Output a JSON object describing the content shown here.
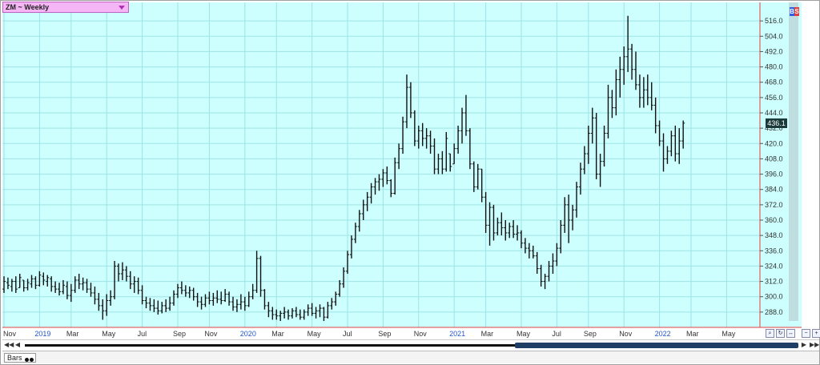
{
  "window": {
    "symbol_label": "ZM ~ Weekly",
    "study_tab_label": "Bars",
    "last_price_label": "436.1",
    "badge_b": "B",
    "badge_s": "S"
  },
  "colors": {
    "plot_background": "#ccfffe",
    "grid": "#9fe3e6",
    "bars": "#111111",
    "right_axis_line": "#e04040",
    "right_strip": "#c0dde0"
  },
  "chart_data": {
    "type": "ohlc",
    "title": "ZM ~ Weekly",
    "ylim": [
      276,
      528
    ],
    "y_ticks": [
      288.0,
      300.0,
      312.0,
      324.0,
      336.0,
      348.0,
      360.0,
      372.0,
      384.0,
      396.0,
      408.0,
      420.0,
      432.0,
      444.0,
      456.0,
      468.0,
      480.0,
      492.0,
      504.0,
      516.0
    ],
    "y_tick_labels": [
      "288.0",
      "300.0",
      "312.0",
      "324.0",
      "336.0",
      "348.0",
      "360.0",
      "372.0",
      "384.0",
      "396.0",
      "408.0",
      "420.0",
      "432.0",
      "444.0",
      "456.0",
      "468.0",
      "480.0",
      "492.0",
      "504.0",
      "516.0"
    ],
    "x_labels": [
      {
        "label": "Nov",
        "bar": 0,
        "year": false
      },
      {
        "label": "2019",
        "bar": 9,
        "year": true
      },
      {
        "label": "Mar",
        "bar": 17,
        "year": false
      },
      {
        "label": "May",
        "bar": 26,
        "year": false
      },
      {
        "label": "Jul",
        "bar": 35,
        "year": false
      },
      {
        "label": "Sep",
        "bar": 44,
        "year": false
      },
      {
        "label": "Nov",
        "bar": 52,
        "year": false
      },
      {
        "label": "2020",
        "bar": 61,
        "year": true
      },
      {
        "label": "Mar",
        "bar": 69,
        "year": false
      },
      {
        "label": "May",
        "bar": 78,
        "year": false
      },
      {
        "label": "Jul",
        "bar": 87,
        "year": false
      },
      {
        "label": "Sep",
        "bar": 96,
        "year": false
      },
      {
        "label": "Nov",
        "bar": 105,
        "year": false
      },
      {
        "label": "2021",
        "bar": 114,
        "year": true
      },
      {
        "label": "Mar",
        "bar": 122,
        "year": false
      },
      {
        "label": "May",
        "bar": 131,
        "year": false
      },
      {
        "label": "Jul",
        "bar": 140,
        "year": false
      },
      {
        "label": "Sep",
        "bar": 148,
        "year": false
      },
      {
        "label": "Nov",
        "bar": 157,
        "year": false
      },
      {
        "label": "2022",
        "bar": 166,
        "year": true
      },
      {
        "label": "Mar",
        "bar": 174,
        "year": false
      },
      {
        "label": "May",
        "bar": 183,
        "year": false
      }
    ],
    "bar_count": 190,
    "bars": [
      {
        "h": 316,
        "l": 303,
        "o": 306,
        "c": 312
      },
      {
        "h": 315,
        "l": 306,
        "o": 311,
        "c": 309
      },
      {
        "h": 314,
        "l": 304,
        "o": 308,
        "c": 312
      },
      {
        "h": 316,
        "l": 303,
        "o": 312,
        "c": 306
      },
      {
        "h": 318,
        "l": 307,
        "o": 307,
        "c": 315
      },
      {
        "h": 313,
        "l": 304,
        "o": 313,
        "c": 307
      },
      {
        "h": 314,
        "l": 305,
        "o": 307,
        "c": 311
      },
      {
        "h": 317,
        "l": 307,
        "o": 310,
        "c": 314
      },
      {
        "h": 316,
        "l": 306,
        "o": 314,
        "c": 309
      },
      {
        "h": 320,
        "l": 308,
        "o": 309,
        "c": 317
      },
      {
        "h": 319,
        "l": 309,
        "o": 316,
        "c": 313
      },
      {
        "h": 317,
        "l": 308,
        "o": 312,
        "c": 315
      },
      {
        "h": 316,
        "l": 304,
        "o": 314,
        "c": 308
      },
      {
        "h": 312,
        "l": 303,
        "o": 308,
        "c": 306
      },
      {
        "h": 311,
        "l": 301,
        "o": 306,
        "c": 304
      },
      {
        "h": 313,
        "l": 302,
        "o": 304,
        "c": 309
      },
      {
        "h": 312,
        "l": 298,
        "o": 308,
        "c": 301
      },
      {
        "h": 310,
        "l": 296,
        "o": 301,
        "c": 305
      },
      {
        "h": 316,
        "l": 303,
        "o": 305,
        "c": 313
      },
      {
        "h": 318,
        "l": 306,
        "o": 313,
        "c": 310
      },
      {
        "h": 315,
        "l": 305,
        "o": 310,
        "c": 311
      },
      {
        "h": 314,
        "l": 303,
        "o": 311,
        "c": 306
      },
      {
        "h": 311,
        "l": 300,
        "o": 306,
        "c": 303
      },
      {
        "h": 308,
        "l": 294,
        "o": 303,
        "c": 298
      },
      {
        "h": 303,
        "l": 289,
        "o": 298,
        "c": 293
      },
      {
        "h": 298,
        "l": 282,
        "o": 293,
        "c": 289
      },
      {
        "h": 302,
        "l": 285,
        "o": 289,
        "c": 297
      },
      {
        "h": 305,
        "l": 293,
        "o": 297,
        "c": 300
      },
      {
        "h": 328,
        "l": 298,
        "o": 300,
        "c": 324
      },
      {
        "h": 326,
        "l": 312,
        "o": 324,
        "c": 318
      },
      {
        "h": 327,
        "l": 313,
        "o": 318,
        "c": 321
      },
      {
        "h": 324,
        "l": 312,
        "o": 321,
        "c": 316
      },
      {
        "h": 320,
        "l": 306,
        "o": 316,
        "c": 310
      },
      {
        "h": 316,
        "l": 303,
        "o": 310,
        "c": 312
      },
      {
        "h": 315,
        "l": 302,
        "o": 312,
        "c": 305
      },
      {
        "h": 309,
        "l": 294,
        "o": 305,
        "c": 297
      },
      {
        "h": 300,
        "l": 291,
        "o": 297,
        "c": 295
      },
      {
        "h": 299,
        "l": 289,
        "o": 295,
        "c": 293
      },
      {
        "h": 298,
        "l": 288,
        "o": 293,
        "c": 291
      },
      {
        "h": 297,
        "l": 286,
        "o": 291,
        "c": 289
      },
      {
        "h": 296,
        "l": 287,
        "o": 289,
        "c": 293
      },
      {
        "h": 298,
        "l": 288,
        "o": 293,
        "c": 291
      },
      {
        "h": 300,
        "l": 289,
        "o": 291,
        "c": 295
      },
      {
        "h": 305,
        "l": 293,
        "o": 295,
        "c": 302
      },
      {
        "h": 310,
        "l": 299,
        "o": 302,
        "c": 307
      },
      {
        "h": 312,
        "l": 302,
        "o": 307,
        "c": 305
      },
      {
        "h": 309,
        "l": 300,
        "o": 305,
        "c": 303
      },
      {
        "h": 308,
        "l": 299,
        "o": 303,
        "c": 305
      },
      {
        "h": 307,
        "l": 297,
        "o": 305,
        "c": 300
      },
      {
        "h": 303,
        "l": 292,
        "o": 300,
        "c": 296
      },
      {
        "h": 300,
        "l": 290,
        "o": 296,
        "c": 294
      },
      {
        "h": 302,
        "l": 292,
        "o": 294,
        "c": 299
      },
      {
        "h": 304,
        "l": 294,
        "o": 299,
        "c": 297
      },
      {
        "h": 303,
        "l": 293,
        "o": 297,
        "c": 299
      },
      {
        "h": 305,
        "l": 295,
        "o": 299,
        "c": 298
      },
      {
        "h": 304,
        "l": 294,
        "o": 298,
        "c": 297
      },
      {
        "h": 306,
        "l": 296,
        "o": 297,
        "c": 302
      },
      {
        "h": 304,
        "l": 293,
        "o": 302,
        "c": 296
      },
      {
        "h": 300,
        "l": 289,
        "o": 296,
        "c": 292
      },
      {
        "h": 298,
        "l": 288,
        "o": 292,
        "c": 294
      },
      {
        "h": 302,
        "l": 290,
        "o": 294,
        "c": 296
      },
      {
        "h": 300,
        "l": 289,
        "o": 296,
        "c": 293
      },
      {
        "h": 304,
        "l": 292,
        "o": 293,
        "c": 300
      },
      {
        "h": 310,
        "l": 298,
        "o": 300,
        "c": 305
      },
      {
        "h": 336,
        "l": 303,
        "o": 305,
        "c": 330
      },
      {
        "h": 332,
        "l": 300,
        "o": 330,
        "c": 305
      },
      {
        "h": 306,
        "l": 290,
        "o": 305,
        "c": 293
      },
      {
        "h": 296,
        "l": 284,
        "o": 293,
        "c": 289
      },
      {
        "h": 292,
        "l": 282,
        "o": 289,
        "c": 286
      },
      {
        "h": 290,
        "l": 282,
        "o": 286,
        "c": 285
      },
      {
        "h": 289,
        "l": 281,
        "o": 285,
        "c": 287
      },
      {
        "h": 292,
        "l": 283,
        "o": 287,
        "c": 288
      },
      {
        "h": 290,
        "l": 282,
        "o": 288,
        "c": 285
      },
      {
        "h": 291,
        "l": 283,
        "o": 285,
        "c": 289
      },
      {
        "h": 292,
        "l": 284,
        "o": 289,
        "c": 286
      },
      {
        "h": 290,
        "l": 282,
        "o": 286,
        "c": 284
      },
      {
        "h": 290,
        "l": 282,
        "o": 284,
        "c": 288
      },
      {
        "h": 294,
        "l": 285,
        "o": 288,
        "c": 291
      },
      {
        "h": 295,
        "l": 285,
        "o": 291,
        "c": 287
      },
      {
        "h": 292,
        "l": 283,
        "o": 287,
        "c": 289
      },
      {
        "h": 294,
        "l": 284,
        "o": 289,
        "c": 291
      },
      {
        "h": 292,
        "l": 281,
        "o": 291,
        "c": 284
      },
      {
        "h": 296,
        "l": 283,
        "o": 284,
        "c": 293
      },
      {
        "h": 299,
        "l": 290,
        "o": 293,
        "c": 296
      },
      {
        "h": 304,
        "l": 293,
        "o": 296,
        "c": 302
      },
      {
        "h": 313,
        "l": 300,
        "o": 302,
        "c": 310
      },
      {
        "h": 323,
        "l": 307,
        "o": 310,
        "c": 320
      },
      {
        "h": 336,
        "l": 318,
        "o": 320,
        "c": 333
      },
      {
        "h": 348,
        "l": 330,
        "o": 333,
        "c": 345
      },
      {
        "h": 358,
        "l": 342,
        "o": 345,
        "c": 355
      },
      {
        "h": 368,
        "l": 351,
        "o": 355,
        "c": 365
      },
      {
        "h": 376,
        "l": 360,
        "o": 365,
        "c": 372
      },
      {
        "h": 382,
        "l": 367,
        "o": 372,
        "c": 378
      },
      {
        "h": 389,
        "l": 373,
        "o": 378,
        "c": 386
      },
      {
        "h": 393,
        "l": 380,
        "o": 386,
        "c": 390
      },
      {
        "h": 396,
        "l": 383,
        "o": 390,
        "c": 392
      },
      {
        "h": 400,
        "l": 386,
        "o": 392,
        "c": 397
      },
      {
        "h": 402,
        "l": 388,
        "o": 397,
        "c": 391
      },
      {
        "h": 392,
        "l": 378,
        "o": 391,
        "c": 381
      },
      {
        "h": 409,
        "l": 380,
        "o": 381,
        "c": 405
      },
      {
        "h": 420,
        "l": 400,
        "o": 405,
        "c": 416
      },
      {
        "h": 441,
        "l": 412,
        "o": 416,
        "c": 437
      },
      {
        "h": 474,
        "l": 432,
        "o": 437,
        "c": 464
      },
      {
        "h": 468,
        "l": 440,
        "o": 464,
        "c": 444
      },
      {
        "h": 446,
        "l": 418,
        "o": 444,
        "c": 422
      },
      {
        "h": 434,
        "l": 416,
        "o": 422,
        "c": 430
      },
      {
        "h": 436,
        "l": 418,
        "o": 430,
        "c": 424
      },
      {
        "h": 432,
        "l": 416,
        "o": 424,
        "c": 426
      },
      {
        "h": 430,
        "l": 412,
        "o": 426,
        "c": 418
      },
      {
        "h": 424,
        "l": 396,
        "o": 418,
        "c": 400
      },
      {
        "h": 412,
        "l": 396,
        "o": 400,
        "c": 408
      },
      {
        "h": 414,
        "l": 396,
        "o": 408,
        "c": 400
      },
      {
        "h": 429,
        "l": 398,
        "o": 400,
        "c": 424
      },
      {
        "h": 412,
        "l": 398,
        "o": 412,
        "c": 402
      },
      {
        "h": 420,
        "l": 404,
        "o": 404,
        "c": 416
      },
      {
        "h": 434,
        "l": 412,
        "o": 416,
        "c": 430
      },
      {
        "h": 448,
        "l": 420,
        "o": 430,
        "c": 444
      },
      {
        "h": 458,
        "l": 426,
        "o": 444,
        "c": 430
      },
      {
        "h": 432,
        "l": 400,
        "o": 430,
        "c": 404
      },
      {
        "h": 406,
        "l": 382,
        "o": 404,
        "c": 386
      },
      {
        "h": 404,
        "l": 384,
        "o": 386,
        "c": 400
      },
      {
        "h": 400,
        "l": 374,
        "o": 400,
        "c": 378
      },
      {
        "h": 382,
        "l": 350,
        "o": 378,
        "c": 356
      },
      {
        "h": 374,
        "l": 340,
        "o": 356,
        "c": 370
      },
      {
        "h": 372,
        "l": 344,
        "o": 370,
        "c": 350
      },
      {
        "h": 362,
        "l": 348,
        "o": 350,
        "c": 358
      },
      {
        "h": 366,
        "l": 348,
        "o": 358,
        "c": 354
      },
      {
        "h": 360,
        "l": 344,
        "o": 354,
        "c": 350
      },
      {
        "h": 358,
        "l": 346,
        "o": 350,
        "c": 355
      },
      {
        "h": 360,
        "l": 346,
        "o": 355,
        "c": 349
      },
      {
        "h": 356,
        "l": 344,
        "o": 349,
        "c": 350
      },
      {
        "h": 352,
        "l": 338,
        "o": 350,
        "c": 342
      },
      {
        "h": 346,
        "l": 334,
        "o": 342,
        "c": 338
      },
      {
        "h": 342,
        "l": 330,
        "o": 338,
        "c": 336
      },
      {
        "h": 340,
        "l": 330,
        "o": 336,
        "c": 332
      },
      {
        "h": 335,
        "l": 318,
        "o": 332,
        "c": 322
      },
      {
        "h": 325,
        "l": 308,
        "o": 322,
        "c": 312
      },
      {
        "h": 318,
        "l": 306,
        "o": 312,
        "c": 316
      },
      {
        "h": 328,
        "l": 312,
        "o": 316,
        "c": 324
      },
      {
        "h": 334,
        "l": 318,
        "o": 324,
        "c": 328
      },
      {
        "h": 342,
        "l": 324,
        "o": 328,
        "c": 338
      },
      {
        "h": 360,
        "l": 334,
        "o": 338,
        "c": 356
      },
      {
        "h": 378,
        "l": 350,
        "o": 356,
        "c": 372
      },
      {
        "h": 380,
        "l": 342,
        "o": 372,
        "c": 360
      },
      {
        "h": 372,
        "l": 352,
        "o": 360,
        "c": 368
      },
      {
        "h": 390,
        "l": 362,
        "o": 368,
        "c": 386
      },
      {
        "h": 405,
        "l": 380,
        "o": 386,
        "c": 400
      },
      {
        "h": 418,
        "l": 396,
        "o": 400,
        "c": 412
      },
      {
        "h": 434,
        "l": 404,
        "o": 412,
        "c": 428
      },
      {
        "h": 448,
        "l": 420,
        "o": 428,
        "c": 440
      },
      {
        "h": 444,
        "l": 392,
        "o": 440,
        "c": 396
      },
      {
        "h": 412,
        "l": 386,
        "o": 396,
        "c": 406
      },
      {
        "h": 434,
        "l": 402,
        "o": 406,
        "c": 428
      },
      {
        "h": 466,
        "l": 424,
        "o": 428,
        "c": 456
      },
      {
        "h": 462,
        "l": 440,
        "o": 456,
        "c": 448
      },
      {
        "h": 478,
        "l": 442,
        "o": 448,
        "c": 470
      },
      {
        "h": 488,
        "l": 456,
        "o": 470,
        "c": 478
      },
      {
        "h": 496,
        "l": 466,
        "o": 478,
        "c": 488
      },
      {
        "h": 520,
        "l": 476,
        "o": 488,
        "c": 494
      },
      {
        "h": 498,
        "l": 470,
        "o": 494,
        "c": 478
      },
      {
        "h": 492,
        "l": 462,
        "o": 478,
        "c": 466
      },
      {
        "h": 474,
        "l": 448,
        "o": 466,
        "c": 456
      },
      {
        "h": 472,
        "l": 448,
        "o": 456,
        "c": 462
      },
      {
        "h": 474,
        "l": 450,
        "o": 462,
        "c": 456
      },
      {
        "h": 468,
        "l": 446,
        "o": 456,
        "c": 450
      },
      {
        "h": 456,
        "l": 428,
        "o": 450,
        "c": 434
      },
      {
        "h": 438,
        "l": 418,
        "o": 434,
        "c": 422
      },
      {
        "h": 428,
        "l": 398,
        "o": 422,
        "c": 408
      },
      {
        "h": 418,
        "l": 404,
        "o": 408,
        "c": 414
      },
      {
        "h": 430,
        "l": 410,
        "o": 414,
        "c": 426
      },
      {
        "h": 434,
        "l": 406,
        "o": 426,
        "c": 412
      },
      {
        "h": 432,
        "l": 404,
        "o": 412,
        "c": 422
      },
      {
        "h": 438,
        "l": 416,
        "o": 422,
        "c": 436
      }
    ],
    "grid": true
  }
}
